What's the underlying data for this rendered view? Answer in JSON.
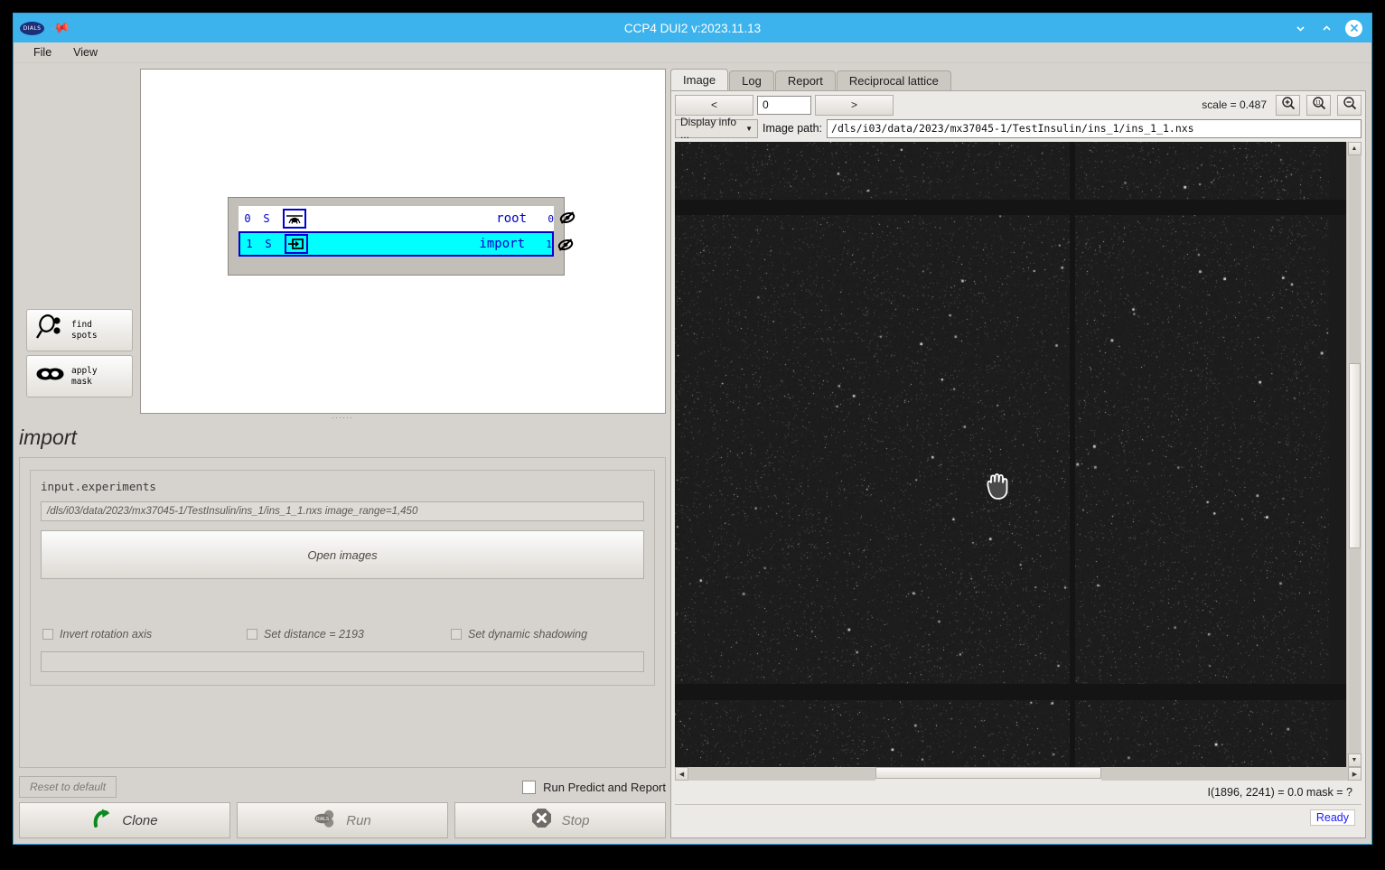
{
  "window": {
    "title": "CCP4 DUI2 v:2023.11.13",
    "logo_text": "DIALS",
    "pin_icon": "pin-icon",
    "minimize_icon": "chevron-down-icon",
    "maximize_icon": "chevron-up-icon",
    "close_icon": "close-icon",
    "accent_color": "#3cb3ec"
  },
  "menubar": {
    "items": [
      {
        "label": "File"
      },
      {
        "label": "View"
      }
    ]
  },
  "tools": [
    {
      "label_line1": "find",
      "label_line2": "spots",
      "icon": "find-spots-icon"
    },
    {
      "label_line1": "apply",
      "label_line2": "mask",
      "icon": "apply-mask-icon"
    }
  ],
  "tree": {
    "nodes": [
      {
        "index": "0",
        "flag": "S",
        "name": "root",
        "count": "0",
        "icon": "root-node-icon",
        "visibility_icon": "eye-slash-icon",
        "selected": false
      },
      {
        "index": "1",
        "flag": "S",
        "name": "import",
        "count": "1",
        "icon": "import-node-icon",
        "visibility_icon": "eye-slash-icon",
        "selected": true
      }
    ]
  },
  "import_panel": {
    "title": "import",
    "param_label": "input.experiments",
    "param_value": "/dls/i03/data/2023/mx37045-1/TestInsulin/ins_1/ins_1_1.nxs image_range=1,450",
    "open_images_label": "Open images",
    "checkboxes": [
      {
        "label": "Invert rotation axis",
        "checked": false
      },
      {
        "label": "Set distance = 2193",
        "checked": false
      },
      {
        "label": "Set dynamic shadowing",
        "checked": false
      }
    ],
    "extra_field_value": "",
    "reset_label": "Reset to default",
    "run_predict_label": "Run Predict and Report",
    "run_predict_checked": false,
    "buttons": [
      {
        "label": "Clone",
        "icon": "clone-arrow-icon",
        "disabled": false
      },
      {
        "label": "Run",
        "icon": "dials-run-icon",
        "disabled": true
      },
      {
        "label": "Stop",
        "icon": "stop-octagon-icon",
        "disabled": true
      }
    ]
  },
  "right_panel": {
    "tabs": [
      {
        "label": "Image",
        "active": true
      },
      {
        "label": "Log",
        "active": false
      },
      {
        "label": "Report",
        "active": false
      },
      {
        "label": "Reciprocal lattice",
        "active": false
      }
    ],
    "nav": {
      "prev_label": "<",
      "next_label": ">",
      "frame_value": "0",
      "scale_label": "scale = 0.487",
      "zoom_in_icon": "zoom-in-icon",
      "zoom_reset_icon": "zoom-one-to-one-icon",
      "zoom_out_icon": "zoom-out-icon"
    },
    "display_info_label": "Display info ...",
    "image_path_label": "Image path:",
    "image_path_value": "/dls/i03/data/2023/mx37045-1/TestInsulin/ins_1/ins_1_1.nxs",
    "cursor_icon": "grab-hand-cursor",
    "pixel_info": "I(1896, 2241) =    0.0  mask = ?",
    "status": "Ready",
    "status_color": "#1a1aff"
  }
}
